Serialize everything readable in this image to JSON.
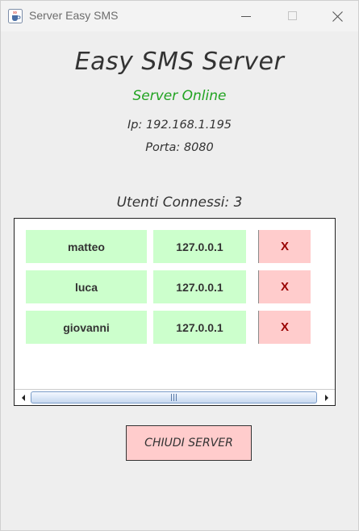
{
  "window": {
    "title": "Server Easy SMS"
  },
  "header": {
    "title": "Easy SMS Server",
    "status": "Server Online",
    "ip": "Ip: 192.168.1.195",
    "port": "Porta: 8080"
  },
  "users": {
    "count_label": "Utenti Connessi: 3",
    "kick_label": "X",
    "rows": [
      {
        "name": "matteo",
        "ip": "127.0.0.1"
      },
      {
        "name": "luca",
        "ip": "127.0.0.1"
      },
      {
        "name": "giovanni",
        "ip": "127.0.0.1"
      }
    ]
  },
  "actions": {
    "close_server_label": "CHIUDI SERVER"
  },
  "colors": {
    "background": "#eeeeee",
    "status_online": "#21a321",
    "user_cell": "#ccffcc",
    "kick_button": "#ffcccc",
    "kick_text": "#990000"
  },
  "icons": {
    "app": "java-cup-icon",
    "minimize": "minimize-icon",
    "maximize": "maximize-icon",
    "close": "close-icon"
  }
}
